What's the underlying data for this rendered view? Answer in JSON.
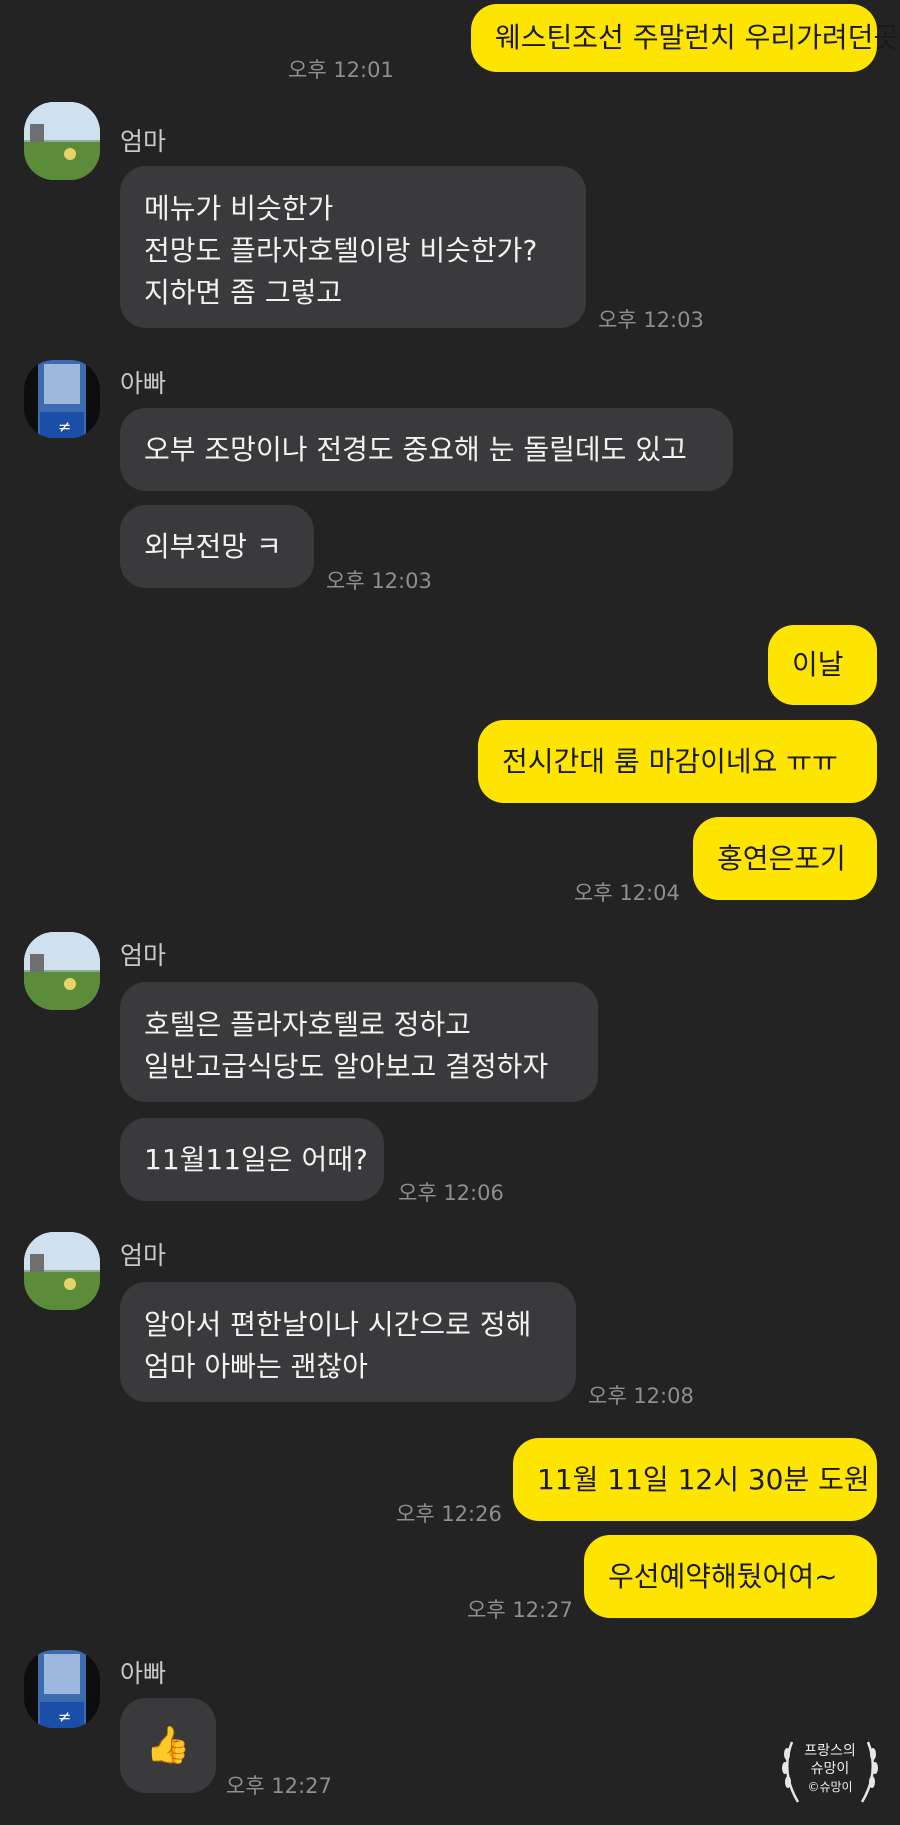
{
  "messages": {
    "m1": {
      "text": "웨스틴조선 주말런치 우리가려던곳",
      "time": "오후 12:01"
    },
    "m2": {
      "sender": "엄마",
      "lines": [
        "메뉴가 비슷한가",
        "전망도 플라자호텔이랑 비슷한가?",
        "지하면 좀 그렇고"
      ],
      "time": "오후 12:03"
    },
    "m3": {
      "sender": "아빠",
      "text": "오부 조망이나 전경도 중요해 눈 돌릴데도 있고"
    },
    "m4": {
      "text": "외부전망 ㅋ",
      "time": "오후 12:03"
    },
    "m5": {
      "text": "이날"
    },
    "m6": {
      "text": "전시간대 룸 마감이네요 ㅠㅠ"
    },
    "m7": {
      "text": "홍연은포기",
      "time": "오후 12:04"
    },
    "m8": {
      "sender": "엄마",
      "lines": [
        "호텔은 플라자호텔로 정하고",
        "일반고급식당도 알아보고 결정하자"
      ]
    },
    "m9": {
      "text": "11월11일은 어때?",
      "time": "오후 12:06"
    },
    "m10": {
      "sender": "엄마",
      "lines": [
        "알아서 편한날이나 시간으로 정해",
        "엄마 아빠는 괜찮아"
      ],
      "time": "오후 12:08"
    },
    "m11": {
      "text": "11월 11일 12시 30분 도원",
      "time": "오후 12:26"
    },
    "m12": {
      "text": "우선예약해뒀어여~",
      "time": "오후 12:27"
    },
    "m13": {
      "sender": "아빠",
      "text": "👍",
      "time": "오후 12:27"
    }
  },
  "watermark": {
    "line1": "프랑스의",
    "line2": "슈망이",
    "line3": "©슈망이"
  },
  "colors": {
    "background": "#232323",
    "my_bubble": "#FEE500",
    "other_bubble": "#3a3a3c"
  }
}
